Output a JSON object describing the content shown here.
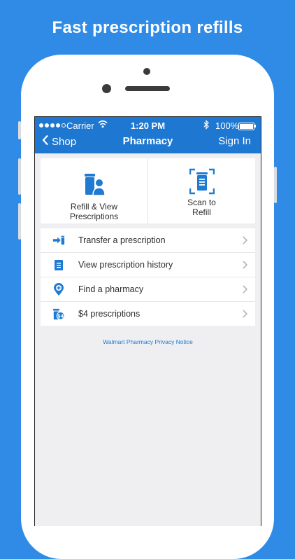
{
  "headline": "Fast prescription refills",
  "status_bar": {
    "carrier": "Carrier",
    "time": "1:20 PM",
    "battery": "100%"
  },
  "nav": {
    "back_label": "Shop",
    "title": "Pharmacy",
    "signin_label": "Sign In"
  },
  "tiles": [
    {
      "line1": "Refill & View",
      "line2": "Prescriptions",
      "icon": "pill-bottle-user-icon"
    },
    {
      "line1": "Scan to",
      "line2": "Refill",
      "icon": "scan-icon"
    }
  ],
  "list": [
    {
      "label": "Transfer a prescription",
      "icon": "transfer-icon"
    },
    {
      "label": "View prescription history",
      "icon": "document-icon"
    },
    {
      "label": "Find a pharmacy",
      "icon": "location-pin-icon"
    },
    {
      "label": "$4 prescriptions",
      "icon": "bottle-four-dollar-icon"
    }
  ],
  "privacy_link": "Walmart Pharmacy Privacy Notice",
  "colors": {
    "background": "#2f8be6",
    "nav_bar": "#1e78d2",
    "icon": "#1f7ad1"
  }
}
